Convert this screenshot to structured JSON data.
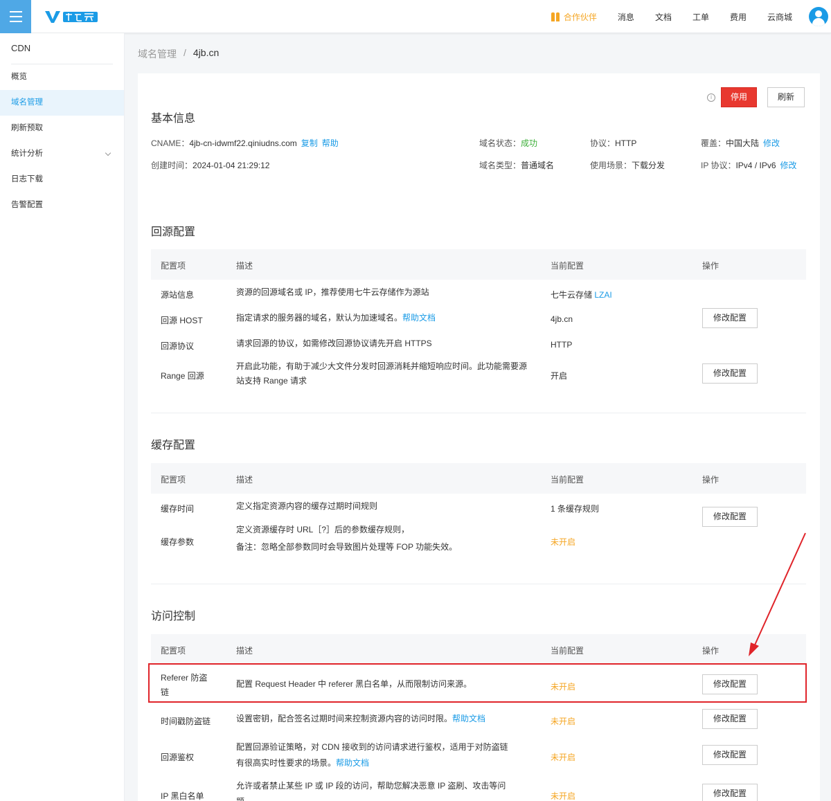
{
  "topbar": {
    "brand": "七牛云",
    "nav": [
      {
        "label": "合作伙伴",
        "highlight": true
      },
      {
        "label": "消息"
      },
      {
        "label": "文档"
      },
      {
        "label": "工单"
      },
      {
        "label": "费用"
      },
      {
        "label": "云商城"
      }
    ],
    "accent": "#1a9be6",
    "partner_color": "#f5a623"
  },
  "sidebar": {
    "title": "CDN",
    "items": [
      {
        "label": "概览"
      },
      {
        "label": "域名管理",
        "active": true
      },
      {
        "label": "刷新预取"
      },
      {
        "label": "统计分析",
        "expandable": true
      },
      {
        "label": "日志下载"
      },
      {
        "label": "告警配置"
      }
    ]
  },
  "breadcrumb": {
    "parent": "域名管理",
    "separator": "/",
    "current": "4jb.cn"
  },
  "actions": {
    "info": "i",
    "stop": "停用",
    "refresh": "刷新"
  },
  "basic_info": {
    "title": "基本信息",
    "cname_label": "CNAME：",
    "cname_value": "4jb-cn-idwmf22.qiniudns.com",
    "copy": "复制",
    "help": "帮助",
    "created_label": "创建时间：",
    "created_value": "2024-01-04 21:29:12",
    "status_label": "域名状态：",
    "status_value": "成功",
    "type_label": "域名类型：",
    "type_value": "普通域名",
    "protocol_label": "协议：",
    "protocol_value": "HTTP",
    "scene_label": "使用场景：",
    "scene_value": "下载分发",
    "coverage_label": "覆盖：",
    "coverage_value": "中国大陆",
    "coverage_edit": "修改",
    "ip_label": "IP 协议：",
    "ip_value": "IPv4 / IPv6",
    "ip_edit": "修改"
  },
  "table_headers": {
    "item": "配置项",
    "desc": "描述",
    "current": "当前配置",
    "ops": "操作"
  },
  "origin": {
    "title": "回源配置",
    "rows": [
      {
        "item": "源站信息",
        "desc": "资源的回源域名或 IP，推荐使用七牛云存储作为源站",
        "current": "七牛云存储 ",
        "current_link": "LZAI",
        "button": ""
      },
      {
        "item": "回源 HOST",
        "desc": "指定请求的服务器的域名，默认为加速域名。",
        "desc_link": "帮助文档",
        "current": "4jb.cn",
        "button": "修改配置"
      },
      {
        "item": "回源协议",
        "desc": "请求回源的协议，如需修改回源协议请先开启 HTTPS",
        "current": "HTTP",
        "button": ""
      },
      {
        "item": "Range 回源",
        "desc": "开启此功能，有助于减少大文件分发时回源消耗并缩短响应时间。此功能需要源站支持 Range 请求",
        "current": "开启",
        "button": "修改配置"
      }
    ]
  },
  "cache": {
    "title": "缓存配置",
    "rows": [
      {
        "item": "缓存时间",
        "desc": "定义指定资源内容的缓存过期时间规则",
        "current": "1 条缓存规则",
        "button": ""
      },
      {
        "item": "缓存参数",
        "desc": "定义资源缓存时 URL［?］后的参数缓存规则，",
        "desc2": "备注：忽略全部参数同时会导致图片处理等 FOP 功能失效。",
        "current": "未开启",
        "button": "修改配置"
      }
    ]
  },
  "access": {
    "title": "访问控制",
    "rows": [
      {
        "item_line1": "Referer 防盗",
        "item_line2": "链",
        "desc": "配置 Request Header 中 referer 黑白名单，从而限制访问来源。",
        "current": "未开启",
        "button": "修改配置"
      },
      {
        "item": "时间戳防盗链",
        "desc": "设置密钥，配合签名过期时间来控制资源内容的访问时限。",
        "desc_link": "帮助文档",
        "current": "未开启",
        "button": "修改配置"
      },
      {
        "item": "回源鉴权",
        "desc": "配置回源验证策略，对 CDN 接收到的访问请求进行鉴权，适用于对防盗链",
        "desc2": "有很高实时性要求的场景。",
        "desc2_link": "帮助文档",
        "current": "未开启",
        "button": "修改配置"
      },
      {
        "item": "IP 黑白名单",
        "desc": "允许或者禁止某些 IP 或 IP 段的访问，帮助您解决恶意 IP 盗刷、攻击等问",
        "desc2": "题",
        "current": "未开启",
        "button": "修改配置"
      }
    ]
  },
  "annotation_color": "#e0242a"
}
